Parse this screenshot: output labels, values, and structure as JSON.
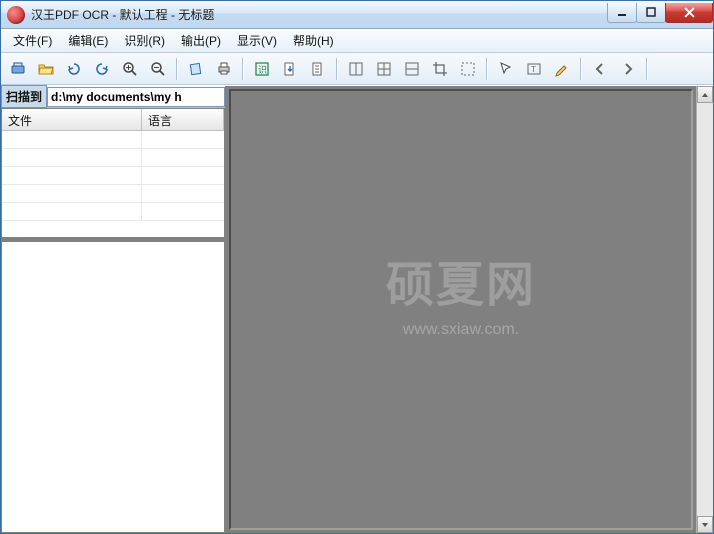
{
  "title": "汉王PDF OCR - 默认工程 - 无标题",
  "menu": {
    "file": "文件(F)",
    "edit": "编辑(E)",
    "recognize": "识别(R)",
    "output": "输出(P)",
    "view": "显示(V)",
    "help": "帮助(H)"
  },
  "left": {
    "scan_to_label": "扫描到",
    "scan_path": "d:\\my documents\\my h",
    "col_file": "文件",
    "col_lang": "语言"
  },
  "watermark": {
    "big": "硕夏网",
    "small": "www.sxiaw.com."
  }
}
